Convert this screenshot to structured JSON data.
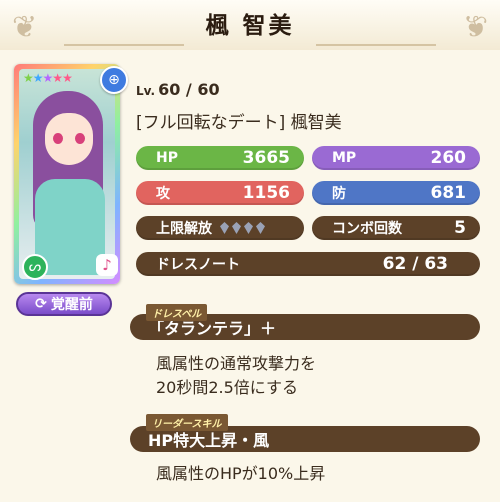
{
  "header": {
    "title": "楓 智美"
  },
  "card": {
    "stars": "★★★★★",
    "awaken_label": "覚醒前"
  },
  "level": {
    "prefix": "Lv.",
    "value": "60 / 60"
  },
  "card_name": "[フル回転なデート] 楓智美",
  "stats": {
    "hp_label": "HP",
    "hp_value": "3665",
    "mp_label": "MP",
    "mp_value": "260",
    "atk_label": "攻",
    "atk_value": "1156",
    "def_label": "防",
    "def_value": "681"
  },
  "limit_break": {
    "label": "上限解放",
    "gems": 4
  },
  "combo": {
    "label": "コンボ回数",
    "value": "5"
  },
  "dress_note": {
    "label": "ドレスノート",
    "value": "62 / 63"
  },
  "dress_spell": {
    "tag": "ドレスペル",
    "name": "「タランテラ」＋",
    "desc_line1": "風属性の通常攻撃力を",
    "desc_line2": "20秒間2.5倍にする"
  },
  "leader_skill": {
    "tag": "リーダースキル",
    "name": "HP特大上昇・風",
    "desc": "風属性のHPが10%上昇"
  },
  "colors": {
    "hp": "#6bb646",
    "mp": "#9a6ad3",
    "atk": "#e1645f",
    "def": "#4f76c6",
    "panel": "#5c4128"
  }
}
